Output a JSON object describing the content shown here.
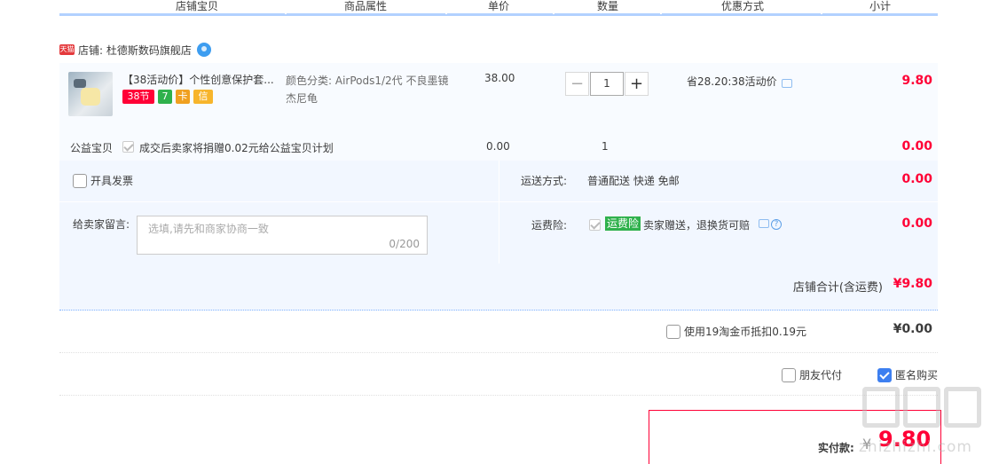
{
  "columns": [
    "店铺宝贝",
    "商品属性",
    "单价",
    "数量",
    "优惠方式",
    "小计"
  ],
  "shop": {
    "badge": "天猫",
    "name": "店铺: 杜德斯数码旗舰店"
  },
  "item": {
    "title": "【38活动价】个性创意保护套...",
    "badges": [
      "38节",
      "7",
      "卡",
      "信"
    ],
    "attr": "颜色分类: AirPods1/2代 不良墨镜杰尼龟",
    "price": "38.00",
    "qty": "1",
    "minus": "−",
    "plus": "+",
    "promo": "省28.20:38活动价",
    "subtotal": "9.80"
  },
  "charity": {
    "label": "公益宝贝",
    "text": "成交后卖家将捐赠0.02元给公益宝贝计划",
    "price": "0.00",
    "qty": "1",
    "subtotal": "0.00"
  },
  "invoice": {
    "label": "开具发票"
  },
  "message": {
    "label": "给卖家留言:",
    "placeholder": "选填,请先和商家协商一致",
    "count": "0/200"
  },
  "shipping": {
    "label": "运送方式:",
    "value": "普通配送 快递 免邮",
    "fee": "0.00"
  },
  "insurance": {
    "label": "运费险:",
    "tag": "运费险",
    "text": "卖家赠送，退换货可赔",
    "help": "?",
    "fee": "0.00"
  },
  "shop_total": {
    "label": "店铺合计(含运费)",
    "amount": "¥9.80"
  },
  "coins": {
    "label": "使用19淘金币抵扣0.19元",
    "amount": "¥0.00"
  },
  "friend_pay": {
    "label": "朋友代付"
  },
  "anonymous": {
    "label": "匿名购买",
    "checked": true
  },
  "payment": {
    "label": "实付款:",
    "currency": "¥",
    "amount": "9.80"
  },
  "watermark": {
    "url": "zhizhizhi.com"
  },
  "colors": {
    "accent": "#ff0036",
    "header_line": "#b2d1ff",
    "bg": "#f2f7ff"
  }
}
